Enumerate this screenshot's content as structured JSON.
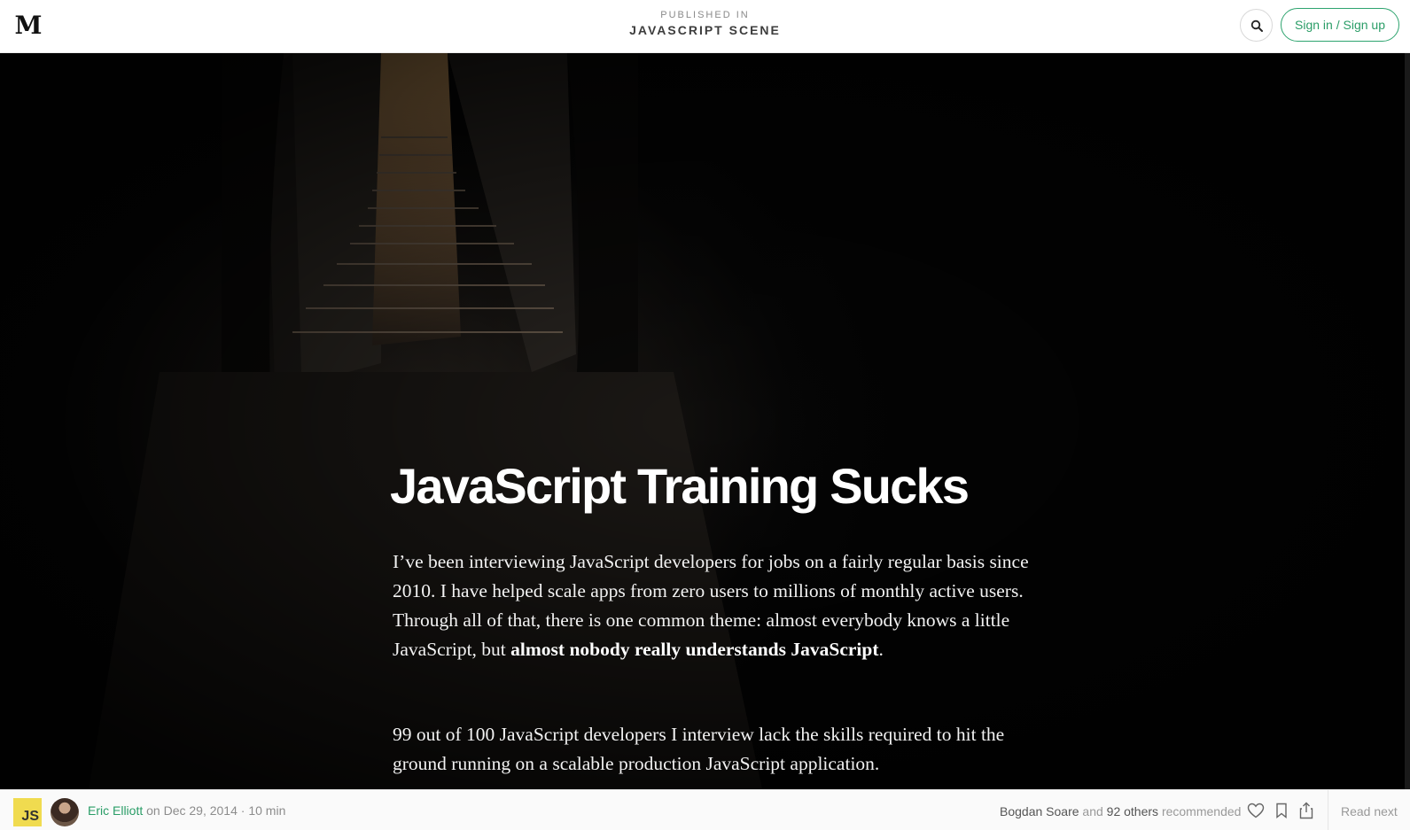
{
  "header": {
    "logo_letter": "M",
    "published_kicker": "PUBLISHED IN",
    "publication_name": "JAVASCRIPT SCENE",
    "search_icon": "search-icon",
    "signin_label": "Sign in / Sign up"
  },
  "article": {
    "title": "JavaScript Training Sucks",
    "para1_text": "I’ve been interviewing JavaScript developers for jobs on a fairly regular basis since 2010. I have helped scale apps from zero users to millions of monthly active users. Through all of that, there is one common theme: almost everybody knows a little JavaScript, but ",
    "para1_bold": "almost nobody really understands JavaScript",
    "para1_end": ".",
    "para2_text": "99 out of 100 JavaScript developers I interview lack the skills required to hit the ground running on a scalable production JavaScript application."
  },
  "footer": {
    "badge_text": "JS",
    "author": "Eric Elliott",
    "on_word": "on",
    "date": "Dec 29, 2014",
    "separator": "·",
    "read_time": "10 min",
    "recommender": "Bogdan Soare",
    "and_word": "and",
    "others_count": "92 others",
    "recommended_word": "recommended",
    "read_next_label": "Read next"
  },
  "colors": {
    "accent_green": "#2a9d67",
    "js_yellow": "#f0db4f",
    "hero_background": "#040404"
  }
}
